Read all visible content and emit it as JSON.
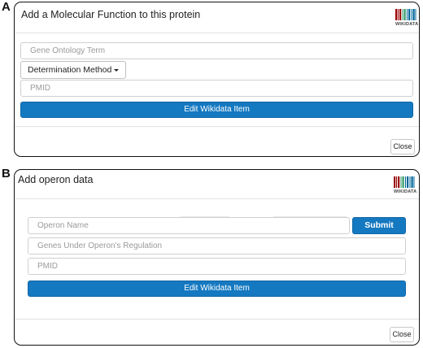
{
  "panel_a": {
    "letter": "A",
    "title": "Add a Molecular Function to this protein",
    "logo_text": "WIKIDATA",
    "go_term_placeholder": "Gene Ontology Term",
    "determination_label": "Determination Method",
    "pmid_placeholder": "PMID",
    "edit_label": "Edit Wikidata Item",
    "close_label": "Close"
  },
  "panel_b": {
    "letter": "B",
    "title": "Add operon data",
    "logo_text": "WIKIDATA",
    "operon_placeholder": "Operon Name",
    "submit_label": "Submit",
    "genes_placeholder": "Genes Under Operon's Regulation",
    "pmid_placeholder": "PMID",
    "edit_label": "Edit Wikidata Item",
    "close_label": "Close"
  },
  "colors": {
    "primary": "#1579c1",
    "border": "#111111",
    "logo_red": "#990000",
    "logo_green": "#339966",
    "logo_blue": "#006699"
  }
}
